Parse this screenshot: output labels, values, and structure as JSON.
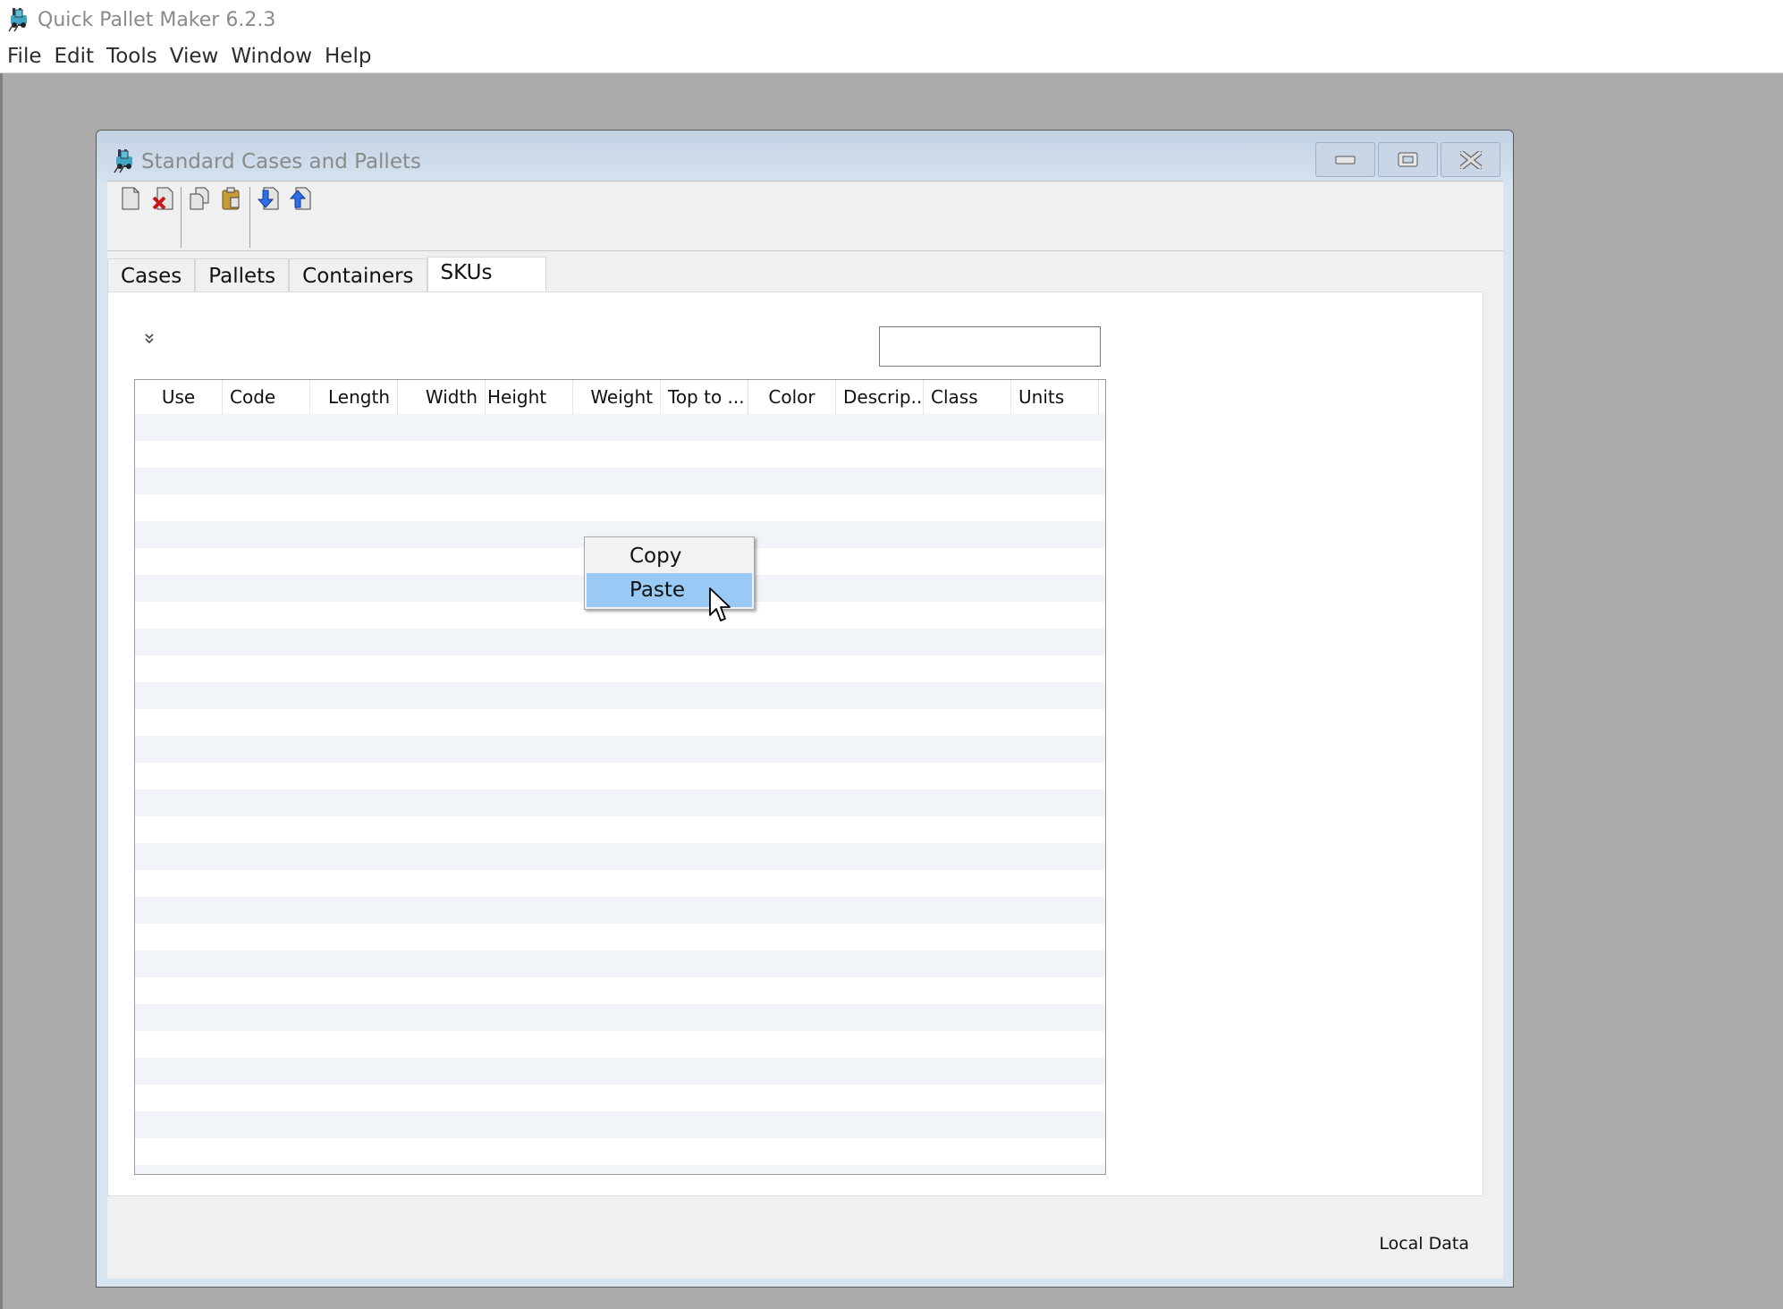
{
  "app": {
    "title": "Quick Pallet Maker 6.2.3",
    "icon": "forklift-icon",
    "menu": [
      "File",
      "Edit",
      "Tools",
      "View",
      "Window",
      "Help"
    ]
  },
  "window": {
    "title": "Standard Cases and Pallets",
    "icon": "forklift-icon",
    "controls": [
      "minimize",
      "maximize",
      "close"
    ]
  },
  "toolbar": {
    "groups": [
      [
        {
          "name": "new-icon",
          "tooltip": "New"
        },
        {
          "name": "delete-icon",
          "tooltip": "Delete"
        }
      ],
      [
        {
          "name": "copy-icon",
          "tooltip": "Copy"
        },
        {
          "name": "paste-icon",
          "tooltip": "Paste"
        }
      ],
      [
        {
          "name": "import-icon",
          "tooltip": "Import"
        },
        {
          "name": "export-icon",
          "tooltip": "Export"
        }
      ]
    ]
  },
  "tabs": [
    {
      "label": "Cases",
      "active": false
    },
    {
      "label": "Pallets",
      "active": false
    },
    {
      "label": "Containers",
      "active": false
    },
    {
      "label": "SKUs",
      "active": true
    }
  ],
  "skus": {
    "expander_glyph": "»",
    "search": {
      "value": "",
      "placeholder": ""
    },
    "columns": [
      {
        "label": "Use",
        "align": "center"
      },
      {
        "label": "Code",
        "align": "left"
      },
      {
        "label": "Length",
        "align": "right"
      },
      {
        "label": "Width",
        "align": "right"
      },
      {
        "label": "Height",
        "align": "left"
      },
      {
        "label": "Weight",
        "align": "right"
      },
      {
        "label": "Top to ...",
        "align": "left"
      },
      {
        "label": "Color",
        "align": "center"
      },
      {
        "label": "Descrip...",
        "align": "left"
      },
      {
        "label": "Class",
        "align": "left"
      },
      {
        "label": "Units",
        "align": "left"
      }
    ],
    "rows": []
  },
  "context_menu": {
    "items": [
      {
        "label": "Copy",
        "highlighted": false
      },
      {
        "label": "Paste",
        "highlighted": true
      }
    ]
  },
  "status": {
    "data_source": "Local Data"
  },
  "colors": {
    "highlight": "#99c9f5",
    "row_alt": "#f1f5fa",
    "titlebar": "#c8d6e6",
    "desktop": "#ababab"
  }
}
